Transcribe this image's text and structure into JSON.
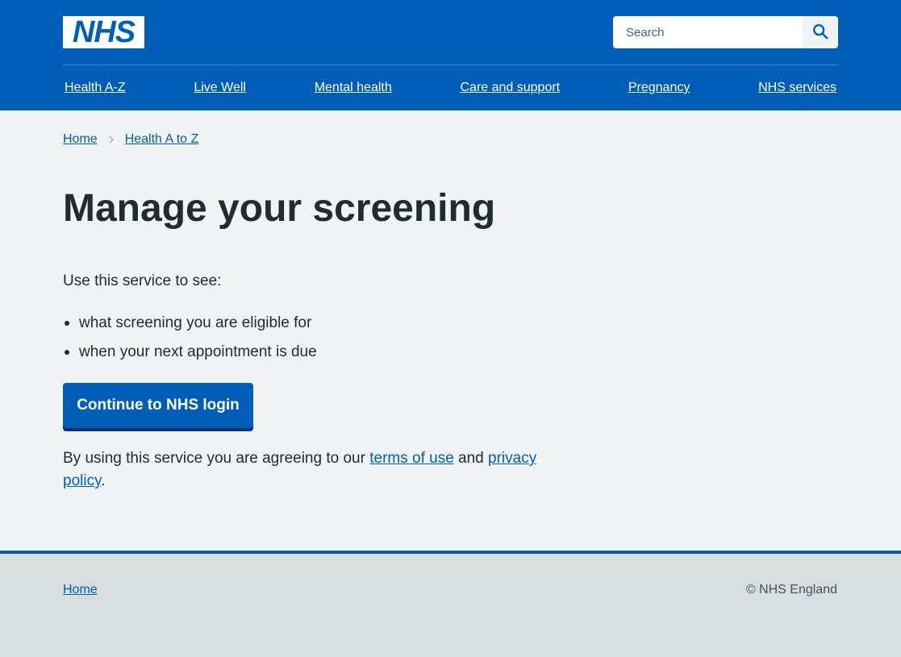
{
  "header": {
    "logo_text": "NHS",
    "search": {
      "placeholder": "Search"
    },
    "nav": [
      {
        "label": "Health A-Z"
      },
      {
        "label": "Live Well"
      },
      {
        "label": "Mental health"
      },
      {
        "label": "Care and support"
      },
      {
        "label": "Pregnancy"
      },
      {
        "label": "NHS services"
      }
    ]
  },
  "breadcrumb": {
    "items": [
      {
        "label": "Home"
      },
      {
        "label": "Health A to Z"
      }
    ]
  },
  "main": {
    "title": "Manage your screening",
    "intro": "Use this service to see:",
    "bullets": [
      "what screening you are eligible for",
      "when your next appointment is due"
    ],
    "cta_label": "Continue to NHS login",
    "agree": {
      "prefix": "By using this service you are agreeing to our ",
      "terms_link": "terms of use",
      "middle": " and ",
      "privacy_link": "privacy policy",
      "suffix": "."
    }
  },
  "footer": {
    "home_link": "Home",
    "copyright": "© NHS England"
  },
  "colors": {
    "brand_blue": "#005eb8",
    "page_background": "#f0f4f5",
    "footer_background": "#d8dde0",
    "text": "#212b32"
  },
  "icons": {
    "search": "search-icon",
    "breadcrumb_separator": "chevron-right-icon"
  }
}
